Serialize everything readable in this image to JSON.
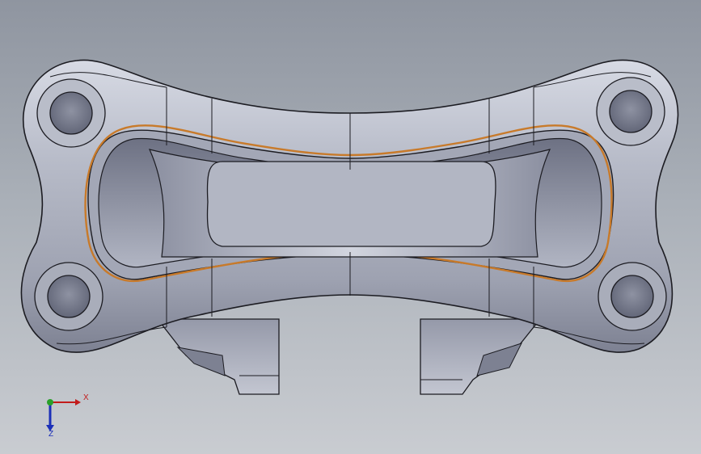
{
  "window": {
    "title": ""
  },
  "viewport": {
    "background_top": "#8f95a0",
    "background_bottom": "#c9ccd1",
    "model": {
      "description_name": "caliper-bracket-part",
      "body_color": "#b9bdc9",
      "edge_color": "#1c1c22",
      "highlight_color": "#c87a2a"
    }
  },
  "triad": {
    "x_label": "X",
    "z_label": "Z",
    "x_color": "#c21b1b",
    "y_color": "#2aa02a",
    "z_color": "#1b2fb8"
  }
}
